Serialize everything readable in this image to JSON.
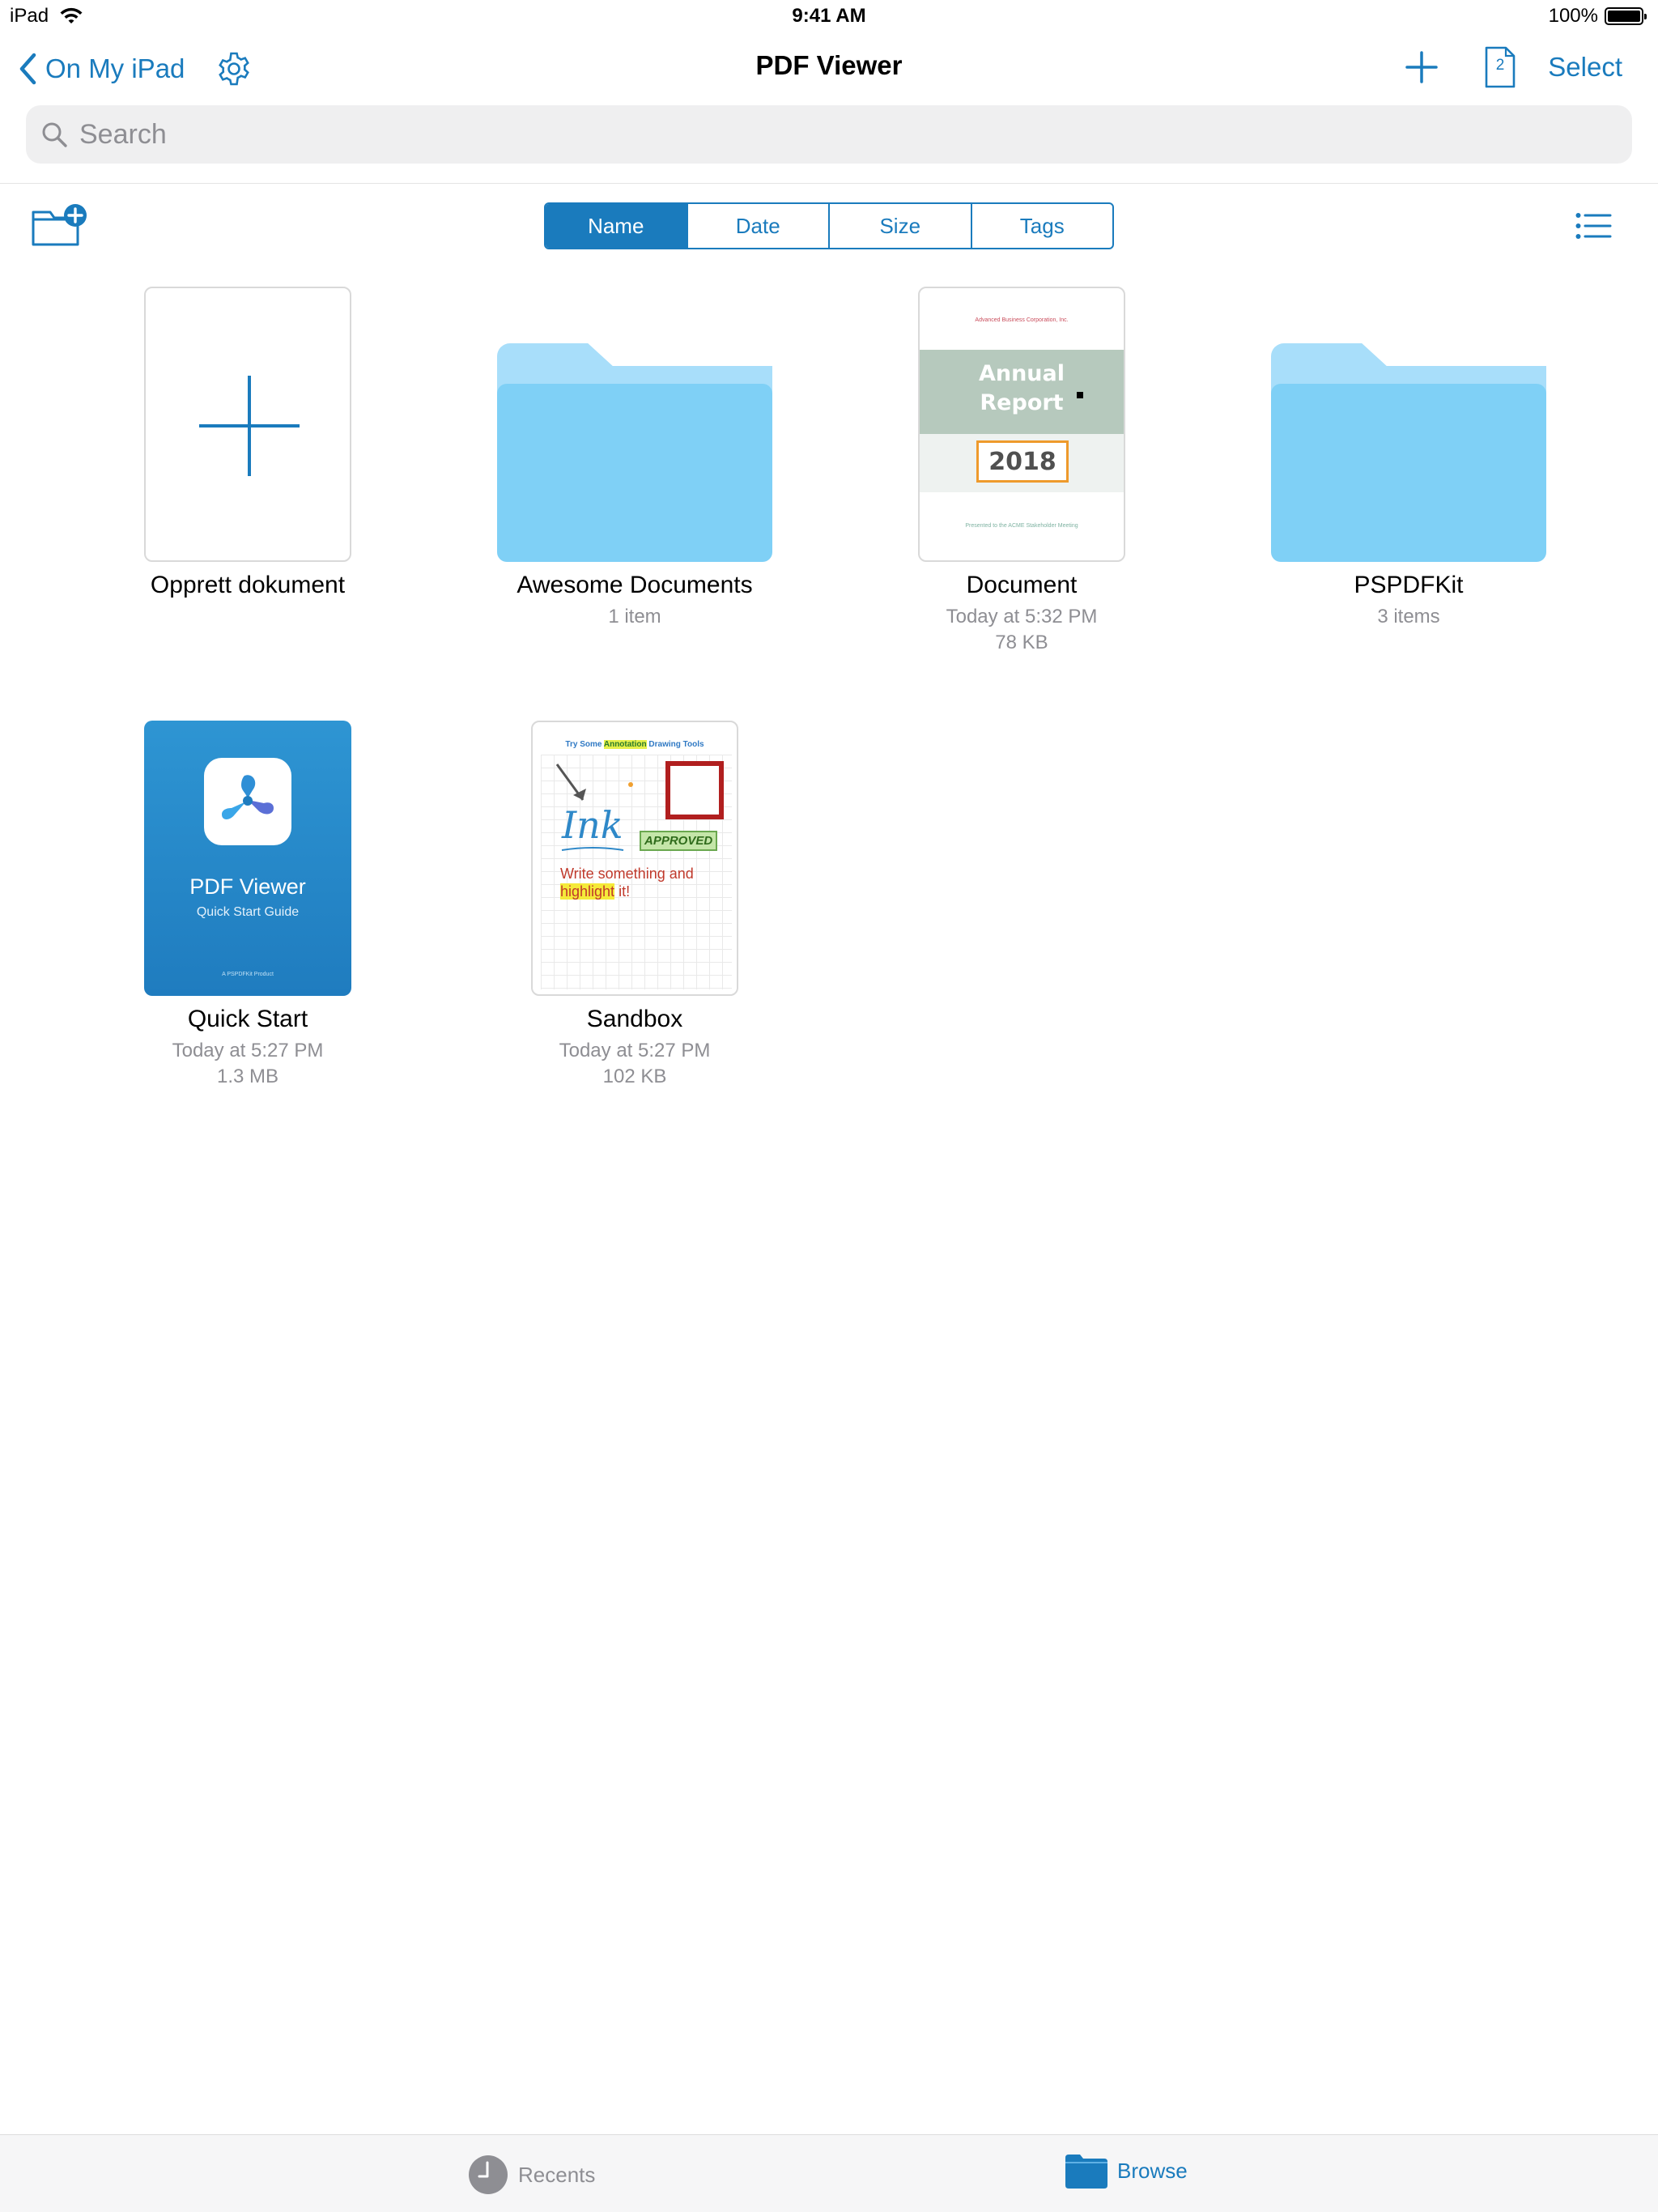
{
  "status_bar": {
    "device": "iPad",
    "time": "9:41 AM",
    "battery": "100%"
  },
  "nav": {
    "back_label": "On My iPad",
    "title": "PDF Viewer",
    "tab_count": "2",
    "select_label": "Select"
  },
  "search": {
    "placeholder": "Search"
  },
  "sort": {
    "options": [
      "Name",
      "Date",
      "Size",
      "Tags"
    ],
    "selected": "Name"
  },
  "items": [
    {
      "name": "Opprett dokument",
      "type": "create"
    },
    {
      "name": "Awesome Documents",
      "type": "folder",
      "meta": [
        "1 item"
      ]
    },
    {
      "name": "Document",
      "type": "pdf",
      "meta": [
        "Today at 5:32 PM",
        "78 KB"
      ],
      "thumb": {
        "header": "Advanced Business Corporation, Inc.",
        "title_line1": "Annual",
        "title_line2": "Report",
        "year": "2018",
        "footer": "Presented to the ACME Stakeholder Meeting"
      }
    },
    {
      "name": "PSPDFKit",
      "type": "folder",
      "meta": [
        "3 items"
      ]
    },
    {
      "name": "Quick Start",
      "type": "pdf",
      "meta": [
        "Today at 5:27 PM",
        "1.3 MB"
      ],
      "thumb": {
        "title": "PDF Viewer",
        "subtitle": "Quick Start Guide",
        "footer": "A PSPDFKit Product"
      }
    },
    {
      "name": "Sandbox",
      "type": "pdf",
      "meta": [
        "Today at 5:27 PM",
        "102 KB"
      ],
      "thumb": {
        "title_a": "Try Some ",
        "title_b": "Annotation",
        "title_c": " Drawing Tools",
        "ink": "Ink",
        "stamp": "APPROVED",
        "write_line1": "Write something and",
        "highlight": "highlight",
        "write_end": " it!"
      }
    }
  ],
  "tabbar": {
    "recents_label": "Recents",
    "browse_label": "Browse",
    "active": "Browse"
  },
  "colors": {
    "accent": "#1a7bbd",
    "folder": "#7fd0f6",
    "folder_tab": "#a8defa",
    "secondary_text": "#8e8e93"
  }
}
